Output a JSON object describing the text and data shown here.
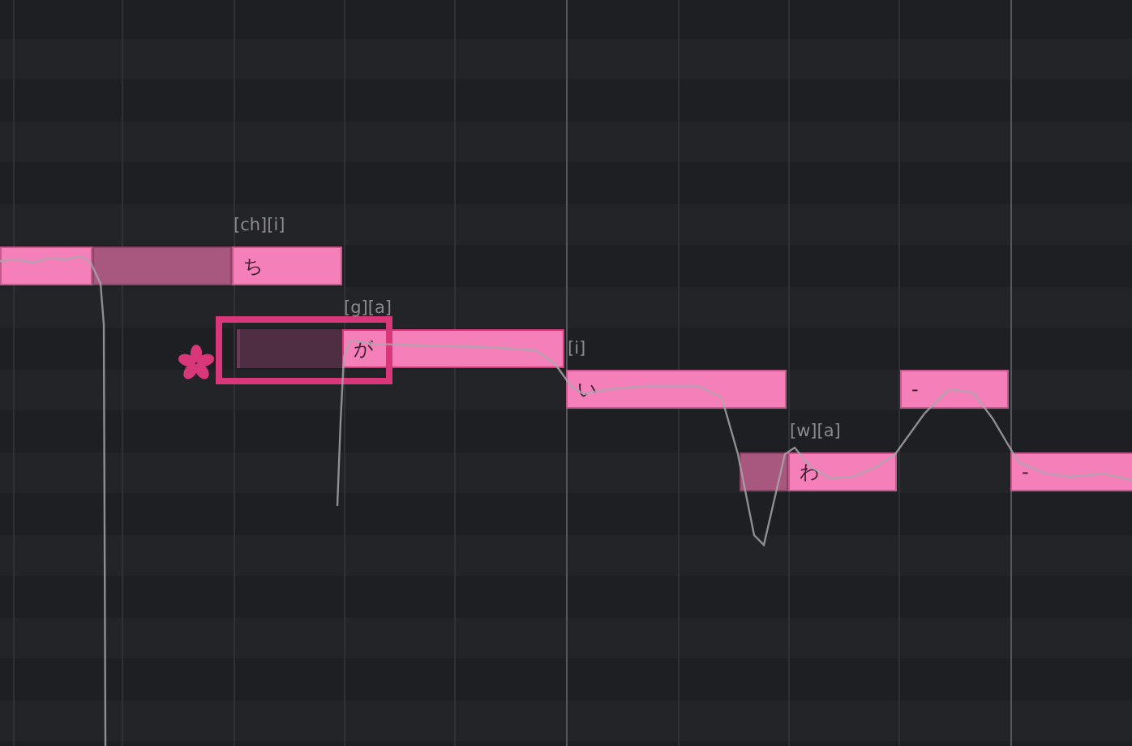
{
  "notes": [
    {
      "selected": false
    },
    {
      "lyric": "ち",
      "phonemes": "[ch][i]",
      "selected": false
    },
    {
      "lyric": "が",
      "phonemes": "[g][a]",
      "selected": true
    },
    {
      "lyric": "い",
      "phonemes": "[i]",
      "selected": false
    },
    {
      "lyric": "わ",
      "phonemes": "[w][a]",
      "selected": false
    },
    {
      "lyric": "-",
      "selected": false
    },
    {
      "lyric": "-",
      "selected": false
    }
  ]
}
